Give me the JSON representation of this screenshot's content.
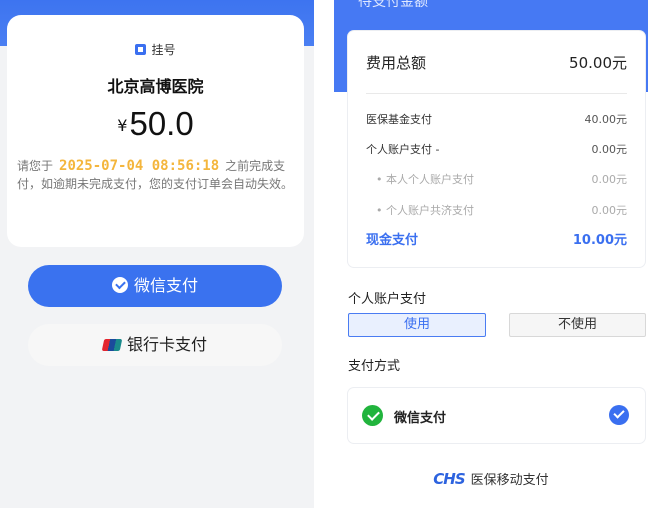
{
  "left": {
    "order": {
      "tag": "挂号",
      "hospital": "北京高博医院",
      "currency_symbol": "¥",
      "amount": "50.0",
      "notice_prefix": "请您于",
      "deadline": "2025-07-04 08:56:18",
      "notice_suffix": "之前完成支付，如逾期未完成支付，您的支付订单会自动失效。"
    },
    "buttons": {
      "wechat": "微信支付",
      "bank": "银行卡支付"
    }
  },
  "right": {
    "header_title_cut": "待支付金额",
    "fee": {
      "total_label": "费用总额",
      "total_value": "50.00元",
      "rows": [
        {
          "label": "医保基金支付",
          "value": "40.00元"
        },
        {
          "label": "个人账户支付 -",
          "value": "0.00元"
        },
        {
          "label": "• 本人个人账户支付",
          "value": "0.00元"
        },
        {
          "label": "• 个人账户共济支付",
          "value": "0.00元"
        }
      ],
      "cash_label": "现金支付",
      "cash_value": "10.00元"
    },
    "personal_account": {
      "title": "个人账户支付",
      "use": "使用",
      "not_use": "不使用"
    },
    "payment_method": {
      "title": "支付方式",
      "option": "微信支付"
    },
    "footer": {
      "logo_text": "CHS",
      "text": "医保移动支付"
    }
  },
  "colors": {
    "primary_blue": "#3a72ef",
    "deadline_orange": "#f4b63d",
    "wechat_green": "#21b43d"
  }
}
